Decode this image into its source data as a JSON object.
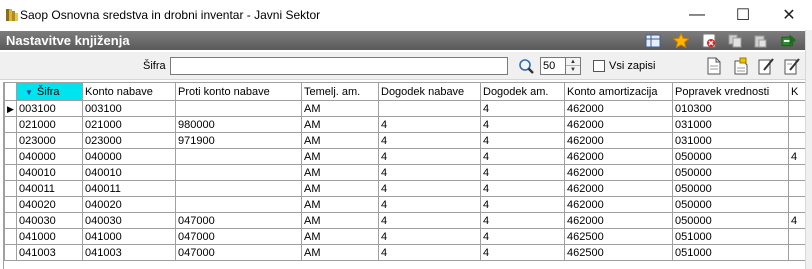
{
  "window": {
    "title": "Saop Osnovna sredstva in drobni inventar  - Javni Sektor",
    "minimize_glyph": "—",
    "maximize_glyph": "☐",
    "close_glyph": "✕"
  },
  "header": {
    "title": "Nastavitve knjiženja",
    "icons": [
      "grid-settings-icon",
      "favorite-star-icon",
      "close-form-icon",
      "copy-icon",
      "paste-icon",
      "exit-icon"
    ]
  },
  "toolbar": {
    "search_label": "Šifra",
    "search_value": "",
    "limit_value": "50",
    "all_records_label": "Vsi zapisi",
    "all_records_checked": false,
    "actions": [
      "new-record-icon",
      "insert-copy-icon",
      "edit-record-icon",
      "edit-all-icon"
    ]
  },
  "grid": {
    "columns": [
      "Šifra",
      "Konto nabave",
      "Proti konto nabave",
      "Temelj. am.",
      "Dogodek nabave",
      "Dogodek am.",
      "Konto amortizacija",
      "Popravek vrednosti",
      "K"
    ],
    "rows": [
      [
        "003100",
        "003100",
        "",
        "AM",
        "",
        "4",
        "462000",
        "010300",
        ""
      ],
      [
        "021000",
        "021000",
        "980000",
        "AM",
        "4",
        "4",
        "462000",
        "031000",
        ""
      ],
      [
        "023000",
        "023000",
        "971900",
        "AM",
        "4",
        "4",
        "462000",
        "031000",
        ""
      ],
      [
        "040000",
        "040000",
        "",
        "AM",
        "4",
        "4",
        "462000",
        "050000",
        "4"
      ],
      [
        "040010",
        "040010",
        "",
        "AM",
        "4",
        "4",
        "462000",
        "050000",
        ""
      ],
      [
        "040011",
        "040011",
        "",
        "AM",
        "4",
        "4",
        "462000",
        "050000",
        ""
      ],
      [
        "040020",
        "040020",
        "",
        "AM",
        "4",
        "4",
        "462000",
        "050000",
        ""
      ],
      [
        "040030",
        "040030",
        "047000",
        "AM",
        "4",
        "4",
        "462000",
        "050000",
        "4"
      ],
      [
        "041000",
        "041000",
        "047000",
        "AM",
        "4",
        "4",
        "462500",
        "051000",
        ""
      ],
      [
        "041003",
        "041003",
        "047000",
        "AM",
        "4",
        "4",
        "462500",
        "051000",
        ""
      ]
    ]
  }
}
